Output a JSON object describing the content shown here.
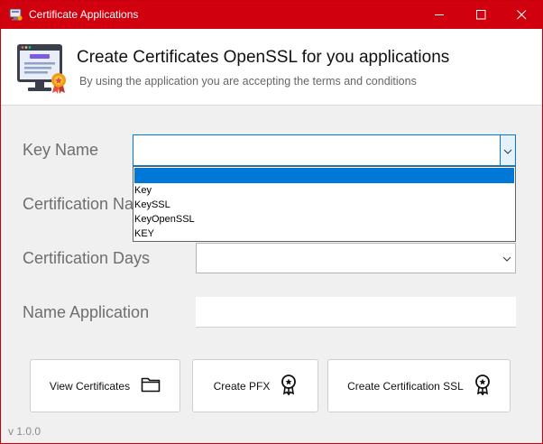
{
  "window": {
    "title": "Certificate Applications",
    "accent_color": "#d0000e"
  },
  "header": {
    "title": "Create Certificates OpenSSL for you applications",
    "subtitle": "By using the application you are accepting the terms and conditions",
    "icon": "computer-certificate-icon"
  },
  "form": {
    "key_name": {
      "label": "Key Name",
      "value": "",
      "options": [
        "",
        "Key",
        "KeySSL",
        "KeyOpenSSL",
        "KEY"
      ],
      "selected_index": 0
    },
    "certification_name": {
      "label": "Certification Name"
    },
    "certification_days": {
      "label": "Certification Days",
      "value": ""
    },
    "name_application": {
      "label": "Name Application",
      "value": ""
    }
  },
  "buttons": {
    "view_certificates": {
      "label": "View Certificates",
      "icon": "folder-icon"
    },
    "create_pfx": {
      "label": "Create PFX",
      "icon": "award-ribbon-icon"
    },
    "create_ssl": {
      "label": "Create Certification SSL",
      "icon": "award-ribbon-icon"
    }
  },
  "footer": {
    "version": "v 1.0.0"
  }
}
